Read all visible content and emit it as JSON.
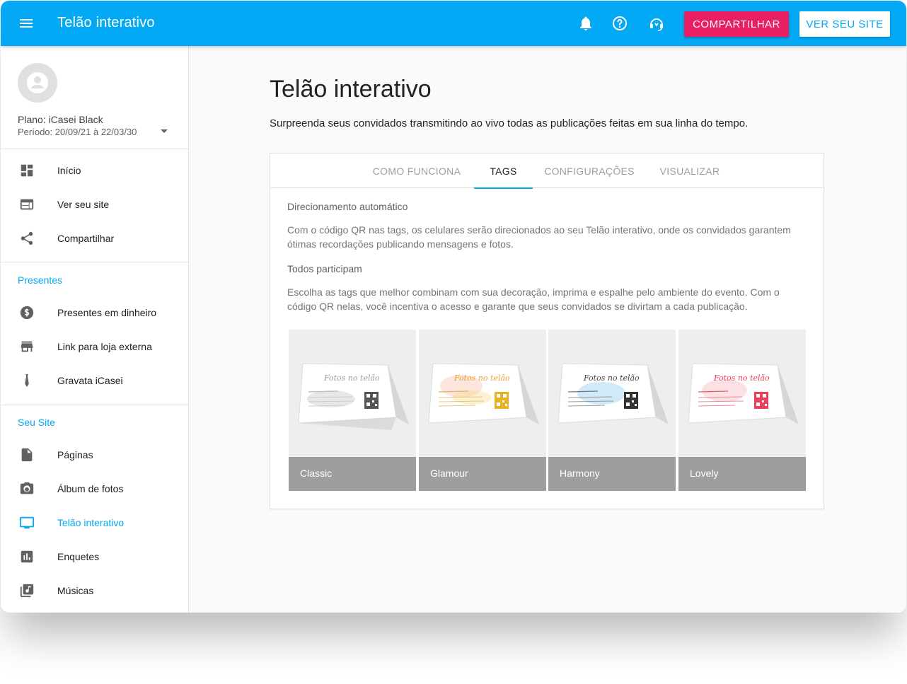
{
  "header": {
    "title": "Telão interativo",
    "share_label": "COMPARTILHAR",
    "site_label": "VER SEU SITE",
    "icons": [
      "menu-icon",
      "bell-icon",
      "help-icon",
      "support-icon"
    ]
  },
  "sidebar": {
    "plan": "Plano: iCasei Black",
    "period": "Período: 20/09/21 à 22/03/30",
    "main_items": [
      {
        "label": "Início",
        "icon": "dashboard-icon"
      },
      {
        "label": "Ver seu site",
        "icon": "web-icon"
      },
      {
        "label": "Compartilhar",
        "icon": "share-icon"
      }
    ],
    "gifts_title": "Presentes",
    "gifts_items": [
      {
        "label": "Presentes em dinheiro",
        "icon": "money-icon"
      },
      {
        "label": "Link para loja externa",
        "icon": "store-icon"
      },
      {
        "label": "Gravata iCasei",
        "icon": "tie-icon"
      }
    ],
    "site_title": "Seu Site",
    "site_items": [
      {
        "label": "Páginas",
        "icon": "page-icon"
      },
      {
        "label": "Álbum de fotos",
        "icon": "camera-icon"
      },
      {
        "label": "Telão interativo",
        "icon": "screen-icon"
      },
      {
        "label": "Enquetes",
        "icon": "poll-icon"
      },
      {
        "label": "Músicas",
        "icon": "music-icon"
      }
    ]
  },
  "main": {
    "title": "Telão interativo",
    "subtitle": "Surpreenda seus convidados transmitindo ao vivo todas as publicações feitas em sua linha do tempo.",
    "tabs": [
      "COMO FUNCIONA",
      "TAGS",
      "CONFIGURAÇÕES",
      "VISUALIZAR"
    ],
    "active_tab": "TAGS",
    "section1_title": "Direcionamento automático",
    "section1_text": "Com o código QR nas tags, os celulares serão direcionados ao seu Telão interativo, onde os convidados garantem ótimas recordações publicando mensagens e fotos.",
    "section2_title": "Todos participam",
    "section2_text": "Escolha as tags que melhor combinam com sua decoração, imprima e espalhe pelo ambiente do evento. Com o código QR nelas, você incentiva o acesso e garante que seus convidados se divirtam a cada publicação.",
    "tags": [
      {
        "name": "Classic",
        "accent": "#9e9e9e"
      },
      {
        "name": "Glamour",
        "accent": "#e6b422"
      },
      {
        "name": "Harmony",
        "accent": "#4fb3e8"
      },
      {
        "name": "Lovely",
        "accent": "#e8405a"
      }
    ]
  },
  "colors": {
    "primary": "#03a9f4",
    "accent": "#e91e63"
  }
}
